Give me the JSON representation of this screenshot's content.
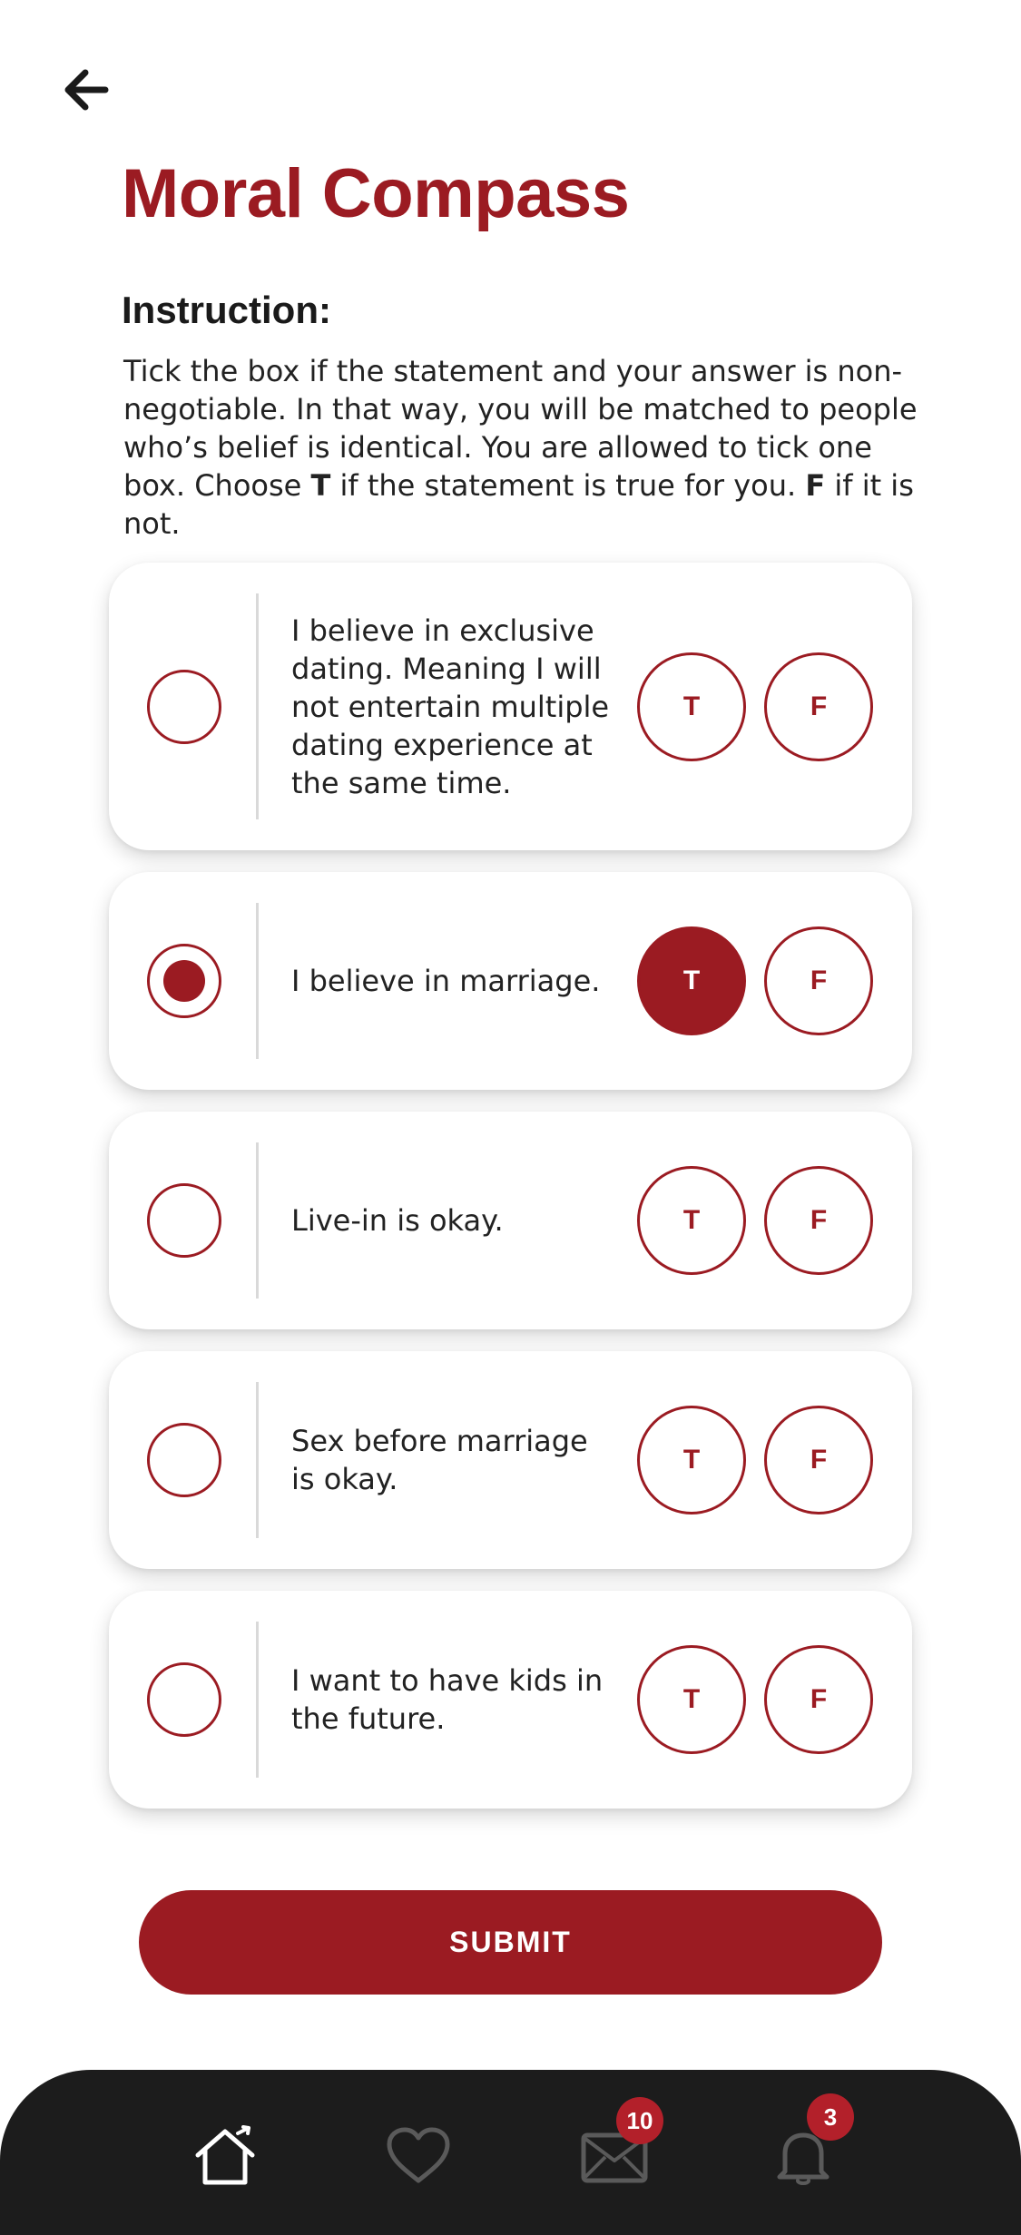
{
  "header": {
    "back_icon": "arrow-left-icon",
    "title": "Moral Compass"
  },
  "instruction": {
    "heading": "Instruction:",
    "text_1": "Tick the box if the statement and your answer is non-negotiable. In that way, you will be matched to people who’s belief is identical. You are allowed to tick one box. Choose ",
    "bold_t": "T",
    "text_2": " if the statement is true for you. ",
    "bold_f": "F",
    "text_3": " if it is not."
  },
  "statements": [
    {
      "text": "I believe in exclusive dating. Meaning I will not entertain multiple dating experience at the same time.",
      "ticked": false,
      "answer": null,
      "true_label": "T",
      "false_label": "F"
    },
    {
      "text": "I believe in marriage.",
      "ticked": true,
      "answer": "T",
      "true_label": "T",
      "false_label": "F"
    },
    {
      "text": "Live-in is okay.",
      "ticked": false,
      "answer": null,
      "true_label": "T",
      "false_label": "F"
    },
    {
      "text": "Sex before marriage is okay.",
      "ticked": false,
      "answer": null,
      "true_label": "T",
      "false_label": "F"
    },
    {
      "text": "I want to have kids in the future.",
      "ticked": false,
      "answer": null,
      "true_label": "T",
      "false_label": "F"
    }
  ],
  "submit_label": "SUBMIT",
  "nav": {
    "items": [
      {
        "icon": "home-icon",
        "active": true
      },
      {
        "icon": "heart-icon",
        "active": false
      },
      {
        "icon": "mail-icon",
        "active": false,
        "badge": "10"
      },
      {
        "icon": "bell-icon",
        "active": false,
        "badge": "3"
      }
    ]
  },
  "colors": {
    "brand": "#9b1b22",
    "nav_background": "#1c1c1c",
    "badge": "#b3202a"
  }
}
